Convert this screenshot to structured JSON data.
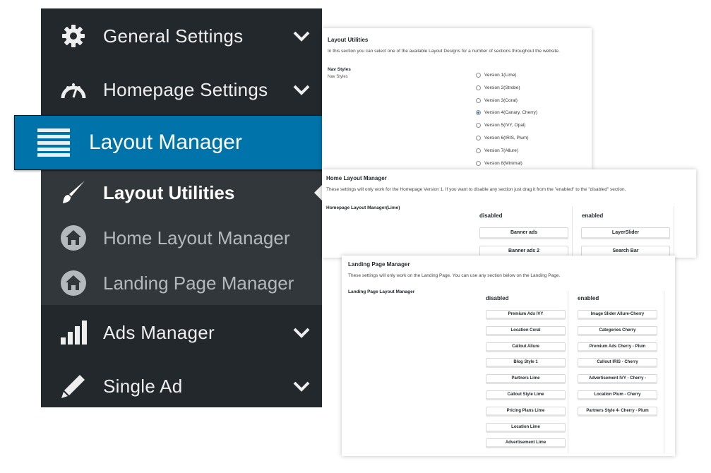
{
  "sidebar": {
    "items": [
      {
        "label": "General Settings",
        "icon": "gear-icon"
      },
      {
        "label": "Homepage Settings",
        "icon": "dashboard-icon"
      },
      {
        "label": "Layout Manager",
        "icon": "menu-icon"
      },
      {
        "label": "Ads Manager",
        "icon": "bar-chart-icon"
      },
      {
        "label": "Single Ad",
        "icon": "pencil-icon"
      }
    ],
    "submenu": [
      {
        "label": "Layout Utilities",
        "icon": "brush-icon"
      },
      {
        "label": "Home Layout Manager",
        "icon": "home-icon"
      },
      {
        "label": "Landing Page Manager",
        "icon": "home-icon"
      }
    ]
  },
  "layout_utilities": {
    "title": "Layout Utilities",
    "description": "In this section you can select one of the available Layout Designs for a number of sections throughout the website.",
    "field_label": "Nav Styles",
    "field_sublabel": "Nav Styles",
    "options": [
      "Version 1(Lime)",
      "Version 2(Strobe)",
      "Version 3(Coral)",
      "Version 4(Canary, Cherry)",
      "Version 5(IVY, Opal)",
      "Version 6(IRIS, Plum)",
      "Version 7(Allure)",
      "Version 8(Minimal)"
    ],
    "selected_index": 3
  },
  "home_layout": {
    "title": "Home Layout Manager",
    "description": "These settings will only work for the Homepage Version 1. If you want to disable any section just drag it from the \"enabled\" to the \"disabled\" section.",
    "field_label": "Homepage Layout Manager(Lime)",
    "disabled_label": "disabled",
    "enabled_label": "enabled",
    "disabled": [
      "Banner ads",
      "Banner ads 2"
    ],
    "enabled": [
      "LayerSlider",
      "Search Bar"
    ]
  },
  "landing_layout": {
    "title": "Landing Page Manager",
    "description": "These settings will only work on the Landing Page. You can use any section below on the Landing Page.",
    "field_label": "Landing Page Layout Manager",
    "disabled_label": "disabled",
    "enabled_label": "enabled",
    "disabled": [
      "Premium Ads IVY",
      "Location Coral",
      "Callout Allure",
      "Blog Style 1",
      "Partners Lime",
      "Callout Style Lime",
      "Pricing Plans Lime",
      "Location Lime",
      "Advertisement Lime"
    ],
    "enabled": [
      "Image Slider Allure-Cherry",
      "Categories Cherry",
      "Premium Ads Cherry - Plum",
      "Callout IRIS - Cherry",
      "Advertisement IVY - Cherry -",
      "Location Plum - Cherry",
      "Partners Style 4- Cherry - Plum"
    ]
  }
}
